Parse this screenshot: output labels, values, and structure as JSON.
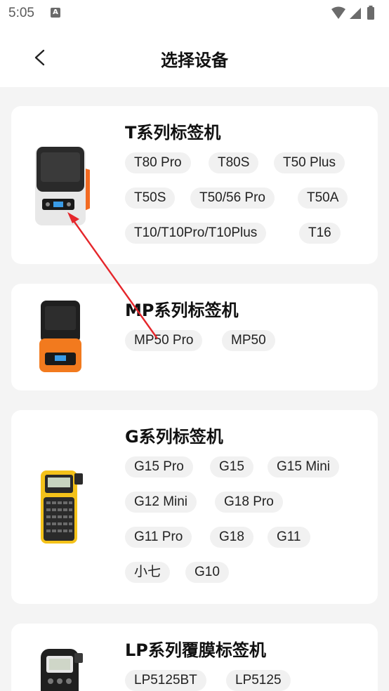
{
  "status_bar": {
    "time": "5:05",
    "notification_icon": "a-icon"
  },
  "header": {
    "title": "选择设备",
    "back_icon": "chevron-left-icon"
  },
  "series": [
    {
      "name": "T系列标签机",
      "models": [
        "T80 Pro",
        "T80S",
        "T50 Plus",
        "T50S",
        "T50/56 Pro",
        "T50A",
        "T10/T10Pro/T10Plus",
        "T16"
      ]
    },
    {
      "name": "MP系列标签机",
      "models": [
        "MP50 Pro",
        "MP50"
      ]
    },
    {
      "name": "G系列标签机",
      "models": [
        "G15 Pro",
        "G15",
        "G15 Mini",
        "G12 Mini",
        "G18 Pro",
        "G11 Pro",
        "G18",
        "G11",
        "小七",
        "G10"
      ]
    },
    {
      "name": "LP系列覆膜标签机",
      "models": [
        "LP5125BT",
        "LP5125"
      ]
    }
  ],
  "colors": {
    "accent_arrow": "#e5262b",
    "background": "#f4f4f4",
    "chip_bg": "#f1f1f1",
    "mp_printer_orange": "#f27a1e",
    "g_printer_yellow": "#f4c21a"
  }
}
